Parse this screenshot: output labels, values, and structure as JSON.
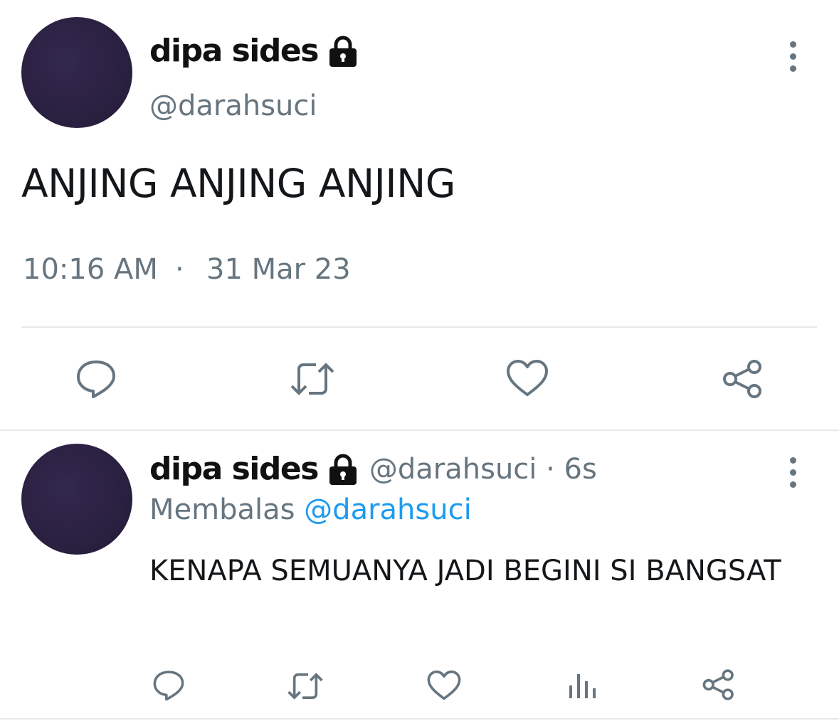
{
  "main_tweet": {
    "display_name": "dipa sides",
    "handle": "@darahsuci",
    "text": "ANJING ANJING ANJING",
    "time": "10:16 AM",
    "separator": "·",
    "date": "31 Mar 23",
    "icons": {
      "verified_lock": "lock-icon",
      "more": "more-vertical-icon",
      "reply": "reply-icon",
      "retweet": "retweet-icon",
      "like": "heart-icon",
      "share": "share-icon"
    }
  },
  "reply_tweet": {
    "display_name": "dipa sides",
    "handle_time": "@darahsuci · 6s",
    "replying_label": "Membalas",
    "replying_to": "@darahsuci",
    "text": "KENAPA SEMUANYA JADI BEGINI SI BANGSAT",
    "icons": {
      "reply": "reply-icon",
      "retweet": "retweet-icon",
      "like": "heart-icon",
      "views": "views-icon",
      "share": "share-icon"
    }
  },
  "colors": {
    "text": "#14171a",
    "muted": "#66757f",
    "link": "#1d9bf0",
    "avatar": "#2a2040",
    "divider": "#e6e9eb"
  }
}
